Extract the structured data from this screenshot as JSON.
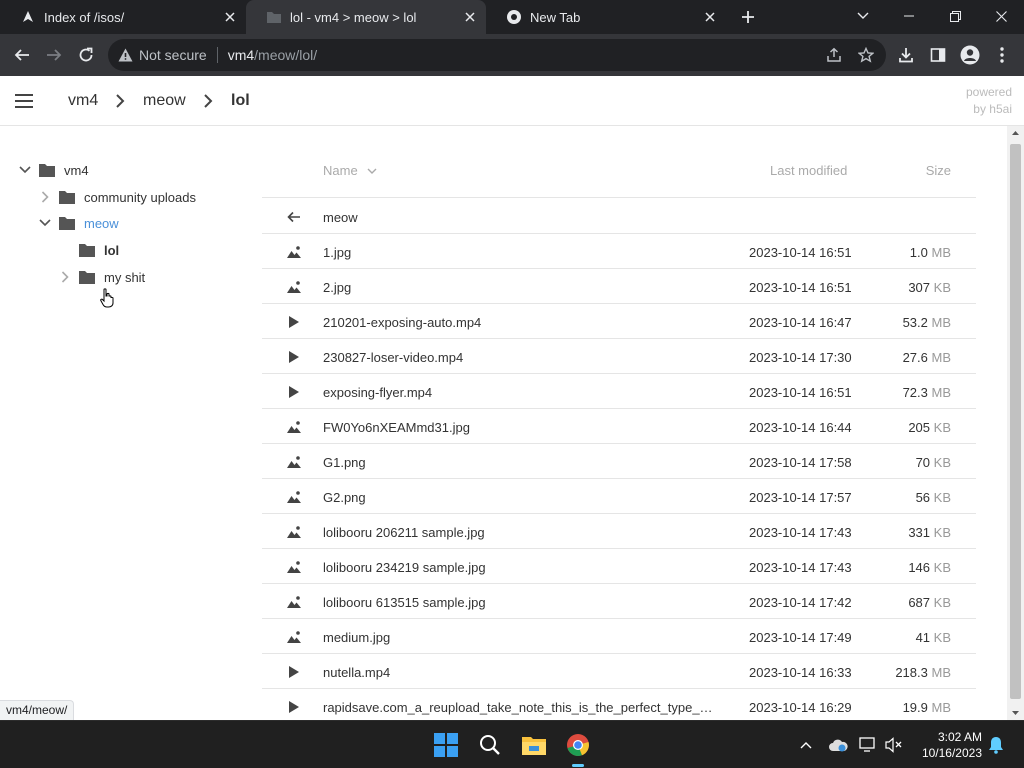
{
  "browser": {
    "tabs": [
      {
        "title": "Index of /isos/",
        "active": false
      },
      {
        "title": "lol - vm4 > meow > lol",
        "active": true
      },
      {
        "title": "New Tab",
        "active": false
      }
    ],
    "address": {
      "secure_label": "Not secure",
      "host": "vm4",
      "path": "/meow/lol/"
    },
    "status_url": "vm4/meow/"
  },
  "header": {
    "breadcrumb": [
      "vm4",
      "meow",
      "lol"
    ],
    "powered_line1": "powered",
    "powered_line2": "by h5ai"
  },
  "tree": [
    {
      "label": "vm4",
      "level": 0,
      "toggle": "open",
      "state": ""
    },
    {
      "label": "community uploads",
      "level": 1,
      "toggle": "closed",
      "state": ""
    },
    {
      "label": "meow",
      "level": 1,
      "toggle": "open",
      "state": "hover"
    },
    {
      "label": "lol",
      "level": 2,
      "toggle": "none",
      "state": "current"
    },
    {
      "label": "my shit",
      "level": 2,
      "toggle": "closed",
      "state": ""
    }
  ],
  "listing": {
    "columns": {
      "name": "Name",
      "modified": "Last modified",
      "size": "Size"
    },
    "parent": "meow",
    "rows": [
      {
        "name": "1.jpg",
        "type": "image",
        "modified": "2023-10-14 16:51",
        "size": "1.0",
        "unit": "MB"
      },
      {
        "name": "2.jpg",
        "type": "image",
        "modified": "2023-10-14 16:51",
        "size": "307",
        "unit": "KB"
      },
      {
        "name": "210201-exposing-auto.mp4",
        "type": "video",
        "modified": "2023-10-14 16:47",
        "size": "53.2",
        "unit": "MB"
      },
      {
        "name": "230827-loser-video.mp4",
        "type": "video",
        "modified": "2023-10-14 17:30",
        "size": "27.6",
        "unit": "MB"
      },
      {
        "name": "exposing-flyer.mp4",
        "type": "video",
        "modified": "2023-10-14 16:51",
        "size": "72.3",
        "unit": "MB"
      },
      {
        "name": "FW0Yo6nXEAMmd31.jpg",
        "type": "image",
        "modified": "2023-10-14 16:44",
        "size": "205",
        "unit": "KB"
      },
      {
        "name": "G1.png",
        "type": "image",
        "modified": "2023-10-14 17:58",
        "size": "70",
        "unit": "KB"
      },
      {
        "name": "G2.png",
        "type": "image",
        "modified": "2023-10-14 17:57",
        "size": "56",
        "unit": "KB"
      },
      {
        "name": "lolibooru 206211 sample.jpg",
        "type": "image",
        "modified": "2023-10-14 17:43",
        "size": "331",
        "unit": "KB"
      },
      {
        "name": "lolibooru 234219 sample.jpg",
        "type": "image",
        "modified": "2023-10-14 17:43",
        "size": "146",
        "unit": "KB"
      },
      {
        "name": "lolibooru 613515 sample.jpg",
        "type": "image",
        "modified": "2023-10-14 17:42",
        "size": "687",
        "unit": "KB"
      },
      {
        "name": "medium.jpg",
        "type": "image",
        "modified": "2023-10-14 17:49",
        "size": "41",
        "unit": "KB"
      },
      {
        "name": "nutella.mp4",
        "type": "video",
        "modified": "2023-10-14 16:33",
        "size": "218.3",
        "unit": "MB"
      },
      {
        "name": "rapidsave.com_a_reupload_take_note_this_is_the_perfect_type_…",
        "type": "video",
        "modified": "2023-10-14 16:29",
        "size": "19.9",
        "unit": "MB"
      }
    ]
  },
  "taskbar": {
    "time": "3:02 AM",
    "date": "10/16/2023"
  },
  "colors": {
    "accent": "#4a90d9",
    "chrome_dark": "#202124",
    "chrome_tab": "#35363a"
  }
}
